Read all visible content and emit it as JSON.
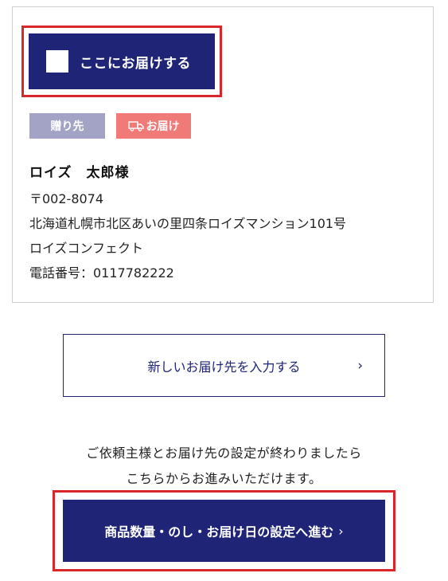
{
  "address_card": {
    "deliver_here_label": "ここにお届けする",
    "badges": {
      "gift_label": "贈り先",
      "delivery_label": "お届け"
    },
    "recipient_name": "ロイズ　太郎様",
    "postal_code": "〒002-8074",
    "address": "北海道札幌市北区あいの里四条ロイズマンション101号",
    "company": "ロイズコンフェクト",
    "phone": "電話番号：0117782222"
  },
  "new_address_button": {
    "label": "新しいお届け先を入力する",
    "chevron": "›"
  },
  "note": {
    "line1": "ご依頼主様とお届け先の設定が終わりましたら",
    "line2": "こちらからお進みいただけます。"
  },
  "proceed_button": {
    "label": "商品数量・のし・お届け日の設定へ進む",
    "chevron": "›"
  },
  "colors": {
    "primary_navy": "#1f2477",
    "highlight_red": "#d9262b",
    "badge_gift": "#a3a3c6",
    "badge_delivery": "#f07a78"
  }
}
